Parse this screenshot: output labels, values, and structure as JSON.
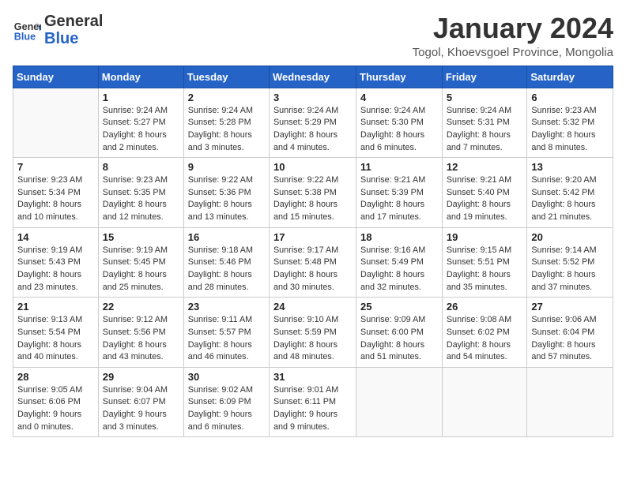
{
  "header": {
    "logo_line1": "General",
    "logo_line2": "Blue",
    "month": "January 2024",
    "location": "Togol, Khoevsgoel Province, Mongolia"
  },
  "weekdays": [
    "Sunday",
    "Monday",
    "Tuesday",
    "Wednesday",
    "Thursday",
    "Friday",
    "Saturday"
  ],
  "weeks": [
    [
      {
        "day": "",
        "info": ""
      },
      {
        "day": "1",
        "info": "Sunrise: 9:24 AM\nSunset: 5:27 PM\nDaylight: 8 hours\nand 2 minutes."
      },
      {
        "day": "2",
        "info": "Sunrise: 9:24 AM\nSunset: 5:28 PM\nDaylight: 8 hours\nand 3 minutes."
      },
      {
        "day": "3",
        "info": "Sunrise: 9:24 AM\nSunset: 5:29 PM\nDaylight: 8 hours\nand 4 minutes."
      },
      {
        "day": "4",
        "info": "Sunrise: 9:24 AM\nSunset: 5:30 PM\nDaylight: 8 hours\nand 6 minutes."
      },
      {
        "day": "5",
        "info": "Sunrise: 9:24 AM\nSunset: 5:31 PM\nDaylight: 8 hours\nand 7 minutes."
      },
      {
        "day": "6",
        "info": "Sunrise: 9:23 AM\nSunset: 5:32 PM\nDaylight: 8 hours\nand 8 minutes."
      }
    ],
    [
      {
        "day": "7",
        "info": "Sunrise: 9:23 AM\nSunset: 5:34 PM\nDaylight: 8 hours\nand 10 minutes."
      },
      {
        "day": "8",
        "info": "Sunrise: 9:23 AM\nSunset: 5:35 PM\nDaylight: 8 hours\nand 12 minutes."
      },
      {
        "day": "9",
        "info": "Sunrise: 9:22 AM\nSunset: 5:36 PM\nDaylight: 8 hours\nand 13 minutes."
      },
      {
        "day": "10",
        "info": "Sunrise: 9:22 AM\nSunset: 5:38 PM\nDaylight: 8 hours\nand 15 minutes."
      },
      {
        "day": "11",
        "info": "Sunrise: 9:21 AM\nSunset: 5:39 PM\nDaylight: 8 hours\nand 17 minutes."
      },
      {
        "day": "12",
        "info": "Sunrise: 9:21 AM\nSunset: 5:40 PM\nDaylight: 8 hours\nand 19 minutes."
      },
      {
        "day": "13",
        "info": "Sunrise: 9:20 AM\nSunset: 5:42 PM\nDaylight: 8 hours\nand 21 minutes."
      }
    ],
    [
      {
        "day": "14",
        "info": "Sunrise: 9:19 AM\nSunset: 5:43 PM\nDaylight: 8 hours\nand 23 minutes."
      },
      {
        "day": "15",
        "info": "Sunrise: 9:19 AM\nSunset: 5:45 PM\nDaylight: 8 hours\nand 25 minutes."
      },
      {
        "day": "16",
        "info": "Sunrise: 9:18 AM\nSunset: 5:46 PM\nDaylight: 8 hours\nand 28 minutes."
      },
      {
        "day": "17",
        "info": "Sunrise: 9:17 AM\nSunset: 5:48 PM\nDaylight: 8 hours\nand 30 minutes."
      },
      {
        "day": "18",
        "info": "Sunrise: 9:16 AM\nSunset: 5:49 PM\nDaylight: 8 hours\nand 32 minutes."
      },
      {
        "day": "19",
        "info": "Sunrise: 9:15 AM\nSunset: 5:51 PM\nDaylight: 8 hours\nand 35 minutes."
      },
      {
        "day": "20",
        "info": "Sunrise: 9:14 AM\nSunset: 5:52 PM\nDaylight: 8 hours\nand 37 minutes."
      }
    ],
    [
      {
        "day": "21",
        "info": "Sunrise: 9:13 AM\nSunset: 5:54 PM\nDaylight: 8 hours\nand 40 minutes."
      },
      {
        "day": "22",
        "info": "Sunrise: 9:12 AM\nSunset: 5:56 PM\nDaylight: 8 hours\nand 43 minutes."
      },
      {
        "day": "23",
        "info": "Sunrise: 9:11 AM\nSunset: 5:57 PM\nDaylight: 8 hours\nand 46 minutes."
      },
      {
        "day": "24",
        "info": "Sunrise: 9:10 AM\nSunset: 5:59 PM\nDaylight: 8 hours\nand 48 minutes."
      },
      {
        "day": "25",
        "info": "Sunrise: 9:09 AM\nSunset: 6:00 PM\nDaylight: 8 hours\nand 51 minutes."
      },
      {
        "day": "26",
        "info": "Sunrise: 9:08 AM\nSunset: 6:02 PM\nDaylight: 8 hours\nand 54 minutes."
      },
      {
        "day": "27",
        "info": "Sunrise: 9:06 AM\nSunset: 6:04 PM\nDaylight: 8 hours\nand 57 minutes."
      }
    ],
    [
      {
        "day": "28",
        "info": "Sunrise: 9:05 AM\nSunset: 6:06 PM\nDaylight: 9 hours\nand 0 minutes."
      },
      {
        "day": "29",
        "info": "Sunrise: 9:04 AM\nSunset: 6:07 PM\nDaylight: 9 hours\nand 3 minutes."
      },
      {
        "day": "30",
        "info": "Sunrise: 9:02 AM\nSunset: 6:09 PM\nDaylight: 9 hours\nand 6 minutes."
      },
      {
        "day": "31",
        "info": "Sunrise: 9:01 AM\nSunset: 6:11 PM\nDaylight: 9 hours\nand 9 minutes."
      },
      {
        "day": "",
        "info": ""
      },
      {
        "day": "",
        "info": ""
      },
      {
        "day": "",
        "info": ""
      }
    ]
  ]
}
